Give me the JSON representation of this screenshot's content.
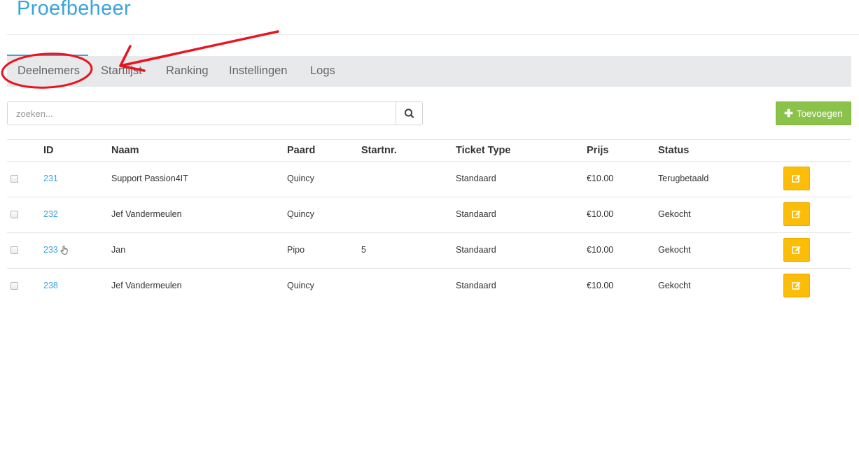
{
  "header": {
    "title": "Proefbeheer"
  },
  "tabs": [
    {
      "label": "Deelnemers"
    },
    {
      "label": "Startlijst"
    },
    {
      "label": "Ranking"
    },
    {
      "label": "Instellingen"
    },
    {
      "label": "Logs"
    }
  ],
  "active_tab": "Deelnemers",
  "search": {
    "placeholder": "zoeken...",
    "value": ""
  },
  "actions": {
    "add_label": "Toevoegen"
  },
  "table": {
    "columns": [
      "ID",
      "Naam",
      "Paard",
      "Startnr.",
      "Ticket Type",
      "Prijs",
      "Status"
    ],
    "rows": [
      {
        "id": "231",
        "naam": "Support Passion4IT",
        "paard": "Quincy",
        "startnr": "",
        "ticket": "Standaard",
        "prijs": "€10.00",
        "status": "Terugbetaald"
      },
      {
        "id": "232",
        "naam": "Jef Vandermeulen",
        "paard": "Quincy",
        "startnr": "",
        "ticket": "Standaard",
        "prijs": "€10.00",
        "status": "Gekocht"
      },
      {
        "id": "233",
        "naam": "Jan",
        "paard": "Pipo",
        "startnr": "5",
        "ticket": "Standaard",
        "prijs": "€10.00",
        "status": "Gekocht"
      },
      {
        "id": "238",
        "naam": "Jef Vandermeulen",
        "paard": "Quincy",
        "startnr": "",
        "ticket": "Standaard",
        "prijs": "€10.00",
        "status": "Gekocht"
      }
    ]
  },
  "icons": {
    "search": "search-icon",
    "add": "plus-icon",
    "edit": "edit-icon",
    "cursor": "hand-pointer-icon"
  },
  "colors": {
    "accent": "#3aa3dd",
    "add_button": "#8bc34a",
    "edit_button": "#fbbd08",
    "annotation": "#e8141f"
  }
}
